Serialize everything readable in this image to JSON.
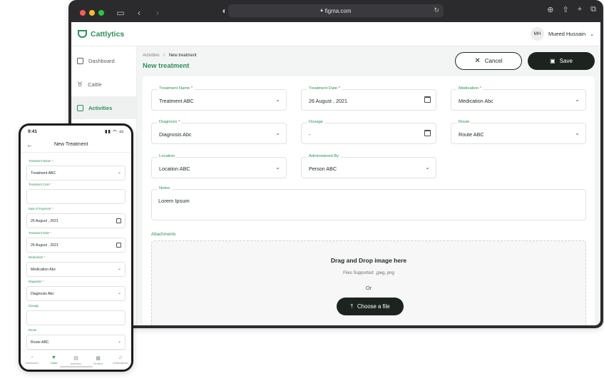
{
  "browser": {
    "url": "figma.com",
    "traffic_lights": [
      "#ff5f57",
      "#febc2e",
      "#28c840"
    ]
  },
  "app": {
    "brand": "Cattlytics",
    "user": {
      "initials": "MH",
      "name": "Mueed Hussain"
    },
    "sidebar": [
      {
        "label": "Dashboard",
        "active": false
      },
      {
        "label": "Cattle",
        "active": false
      },
      {
        "label": "Activities",
        "active": true
      }
    ],
    "breadcrumb": {
      "parent": "Activities",
      "separator": "/",
      "current": "New treatment"
    },
    "title": "New treatment",
    "actions": {
      "cancel": "Cancel",
      "save": "Save"
    },
    "fields": {
      "treatment_name": {
        "label": "Treatment Name",
        "value": "Treatment ABC"
      },
      "treatment_date": {
        "label": "Treatment Date",
        "value": "26 August , 2021"
      },
      "medication": {
        "label": "Medication",
        "value": "Medication Abc"
      },
      "diagnosis": {
        "label": "Diagnosis",
        "value": "Diagnosis Abc"
      },
      "dosage": {
        "label": "Dosage",
        "value": "-"
      },
      "route": {
        "label": "Route",
        "value": "Route ABC"
      },
      "location": {
        "label": "Location",
        "value": "Location ABC"
      },
      "administered_by": {
        "label": "Administered By",
        "value": "Person ABC"
      },
      "notes": {
        "label": "Notes",
        "value": "Lorem Ipsum"
      }
    },
    "attachments": {
      "label": "Attachments",
      "title": "Drag and Drop image here",
      "supported": "Files Supported: .jpeg, png",
      "or": "Or",
      "button": "Choose a file"
    },
    "colors": {
      "brand": "#2f8f5b",
      "dark": "#1d2420",
      "required": "#e0463a"
    }
  },
  "mobile": {
    "time": "9:41",
    "title": "New Treatment",
    "fields": [
      {
        "label": "Treatment Name",
        "value": "Treatment ABC",
        "required": true,
        "suffix": "chevron"
      },
      {
        "label": "Treatment Cost",
        "value": "",
        "required": true,
        "suffix": ""
      },
      {
        "label": "Date of Payment",
        "value": "26 August , 2021",
        "required": true,
        "suffix": "calendar"
      },
      {
        "label": "Treatment Date",
        "value": "26 August , 2021",
        "required": true,
        "suffix": "calendar"
      },
      {
        "label": "Medication",
        "value": "Medication Abc",
        "required": true,
        "suffix": "chevron"
      },
      {
        "label": "Diagnosis",
        "value": "Diagnosis Abc",
        "required": true,
        "suffix": "chevron"
      },
      {
        "label": "Dosage",
        "value": "",
        "required": false,
        "suffix": ""
      },
      {
        "label": "Route",
        "value": "Route ABC",
        "required": false,
        "suffix": "chevron"
      }
    ],
    "tabs": [
      {
        "label": "Dashboard",
        "icon": "dashboard-icon",
        "active": false
      },
      {
        "label": "Cattle",
        "icon": "cattle-icon",
        "active": true
      },
      {
        "label": "Activities",
        "icon": "activities-icon",
        "active": false
      },
      {
        "label": "Timeline",
        "icon": "timeline-icon",
        "active": false
      },
      {
        "label": "Notifications",
        "icon": "bell-icon",
        "active": false
      }
    ]
  }
}
